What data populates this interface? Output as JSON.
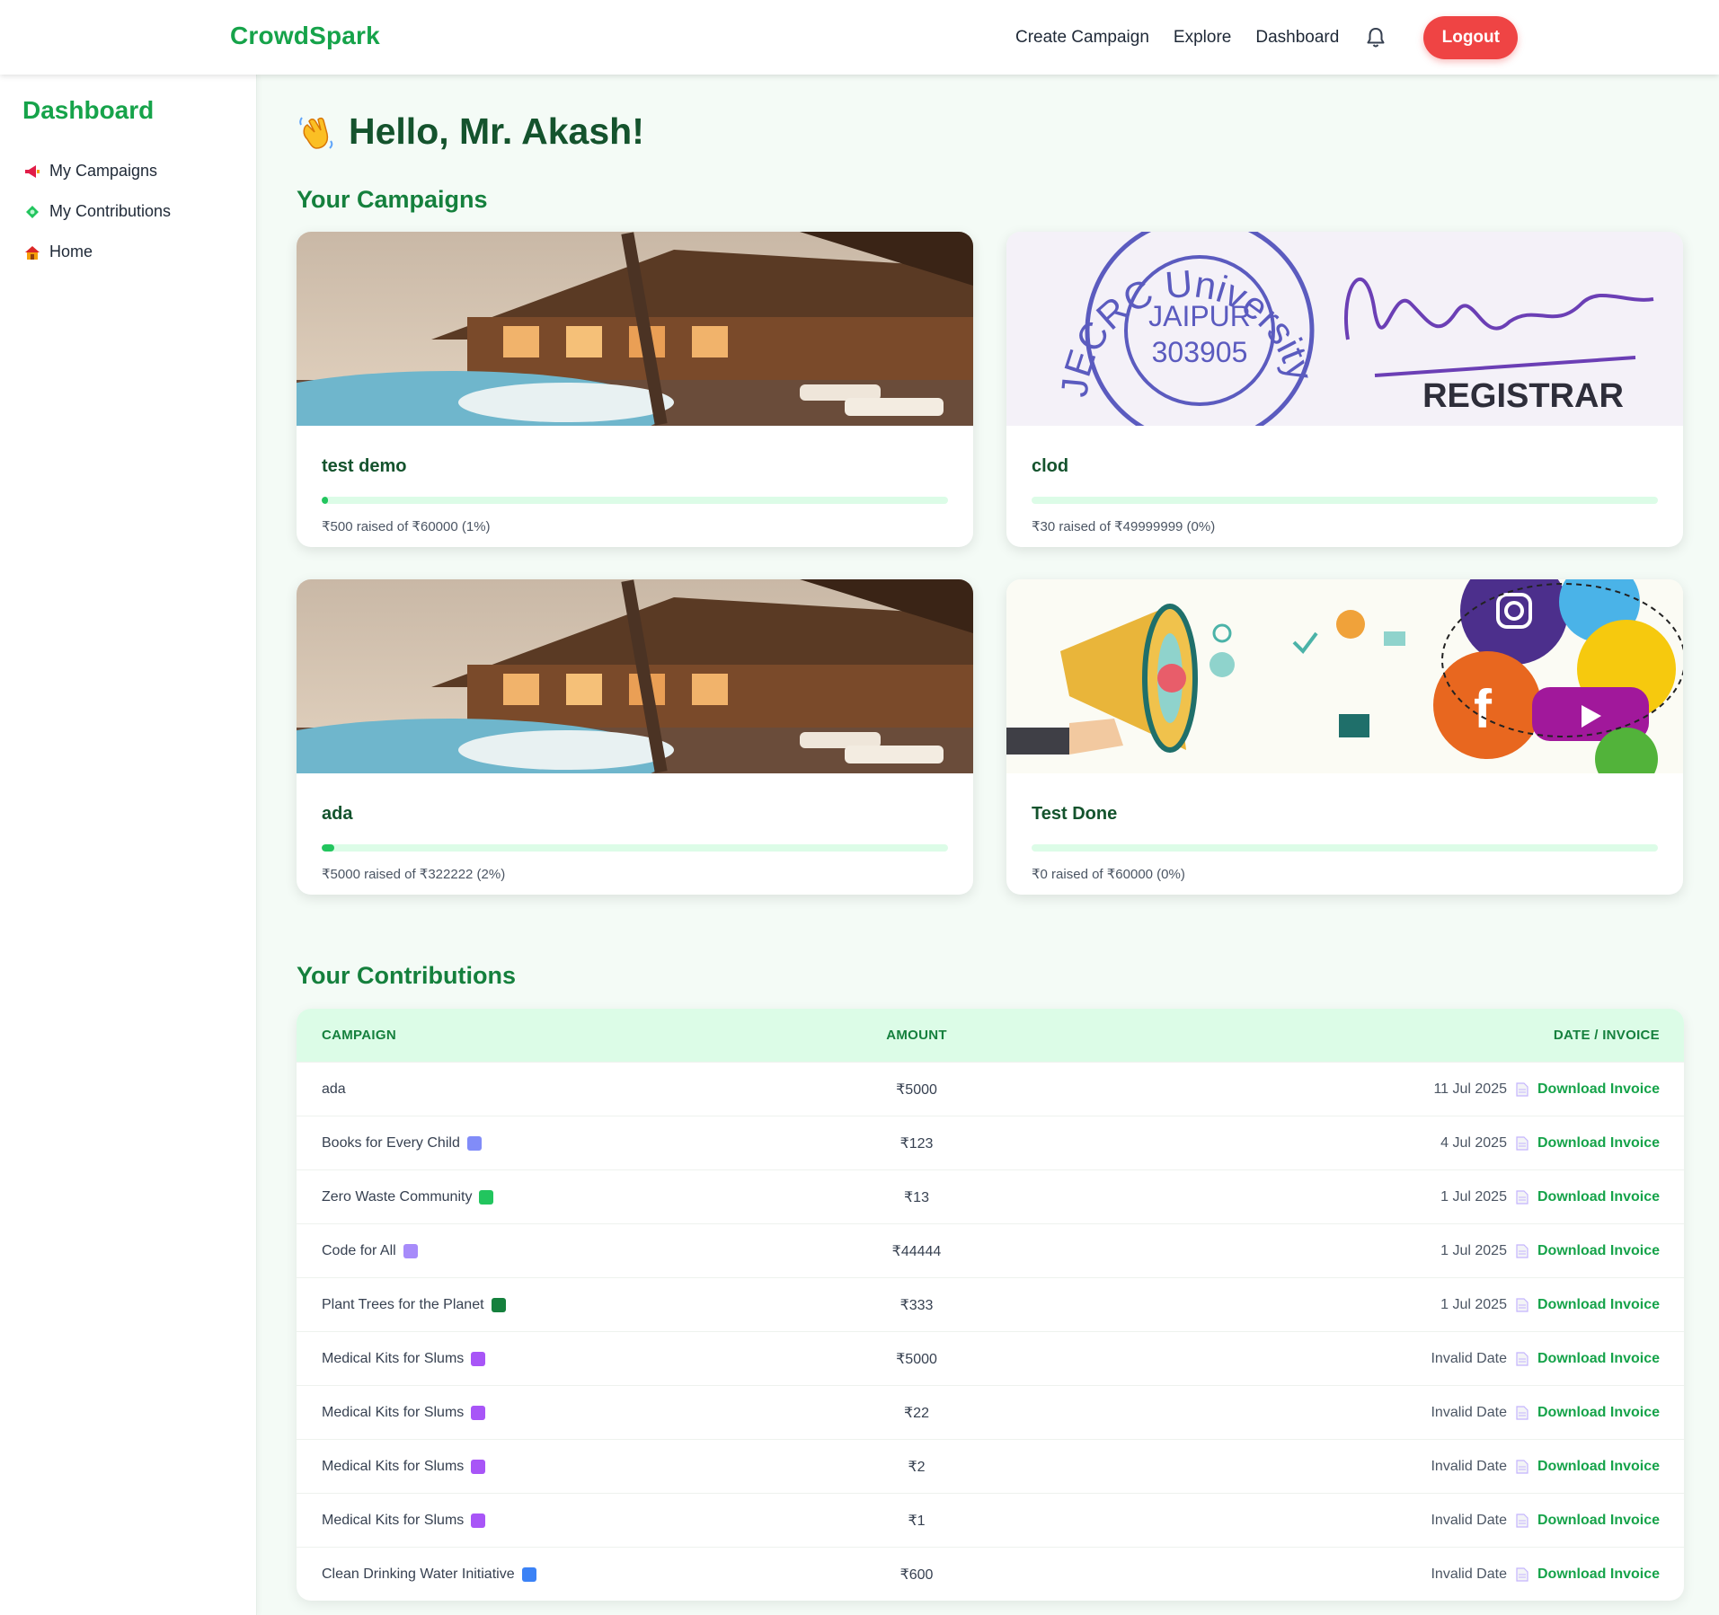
{
  "header": {
    "brand": "CrowdSpark",
    "nav": [
      "Create Campaign",
      "Explore",
      "Dashboard"
    ],
    "logout_label": "Logout"
  },
  "sidebar": {
    "title": "Dashboard",
    "items": [
      {
        "label": "My Campaigns",
        "icon": "megaphone-icon"
      },
      {
        "label": "My Contributions",
        "icon": "money-icon"
      },
      {
        "label": "Home",
        "icon": "home-icon"
      }
    ]
  },
  "greeting": "Hello, Mr. Akash!",
  "campaigns_title": "Your Campaigns",
  "campaigns": [
    {
      "title": "test demo",
      "raised_text": "₹500 raised of ₹60000 (1%)",
      "progress": 0.01,
      "image": "resort-pool-photo"
    },
    {
      "title": "clod",
      "raised_text": "₹30 raised of ₹49999999 (0%)",
      "progress": 0.0,
      "image": "university-stamp-signature",
      "image_text": {
        "seal_ring": "JECRC University",
        "seal_center_1": "JAIPUR",
        "seal_center_2": "303905",
        "caption": "REGISTRAR"
      }
    },
    {
      "title": "ada",
      "raised_text": "₹5000 raised of ₹322222 (2%)",
      "progress": 0.02,
      "image": "resort-pool-photo"
    },
    {
      "title": "Test Done",
      "raised_text": "₹0 raised of ₹60000 (0%)",
      "progress": 0.0,
      "image": "megaphone-social-media-illustration"
    }
  ],
  "contributions_title": "Your Contributions",
  "table": {
    "headers": [
      "CAMPAIGN",
      "AMOUNT",
      "DATE / INVOICE"
    ],
    "invoice_label": "Download Invoice",
    "rows": [
      {
        "campaign": "ada",
        "amount": "₹5000",
        "date": "11 Jul 2025",
        "emoji": ""
      },
      {
        "campaign": "Books for Every Child",
        "amount": "₹123",
        "date": "4 Jul 2025",
        "emoji": "books-icon"
      },
      {
        "campaign": "Zero Waste Community",
        "amount": "₹13",
        "date": "1 Jul 2025",
        "emoji": "recycle-icon"
      },
      {
        "campaign": "Code for All",
        "amount": "₹44444",
        "date": "1 Jul 2025",
        "emoji": "coder-icon"
      },
      {
        "campaign": "Plant Trees for the Planet",
        "amount": "₹333",
        "date": "1 Jul 2025",
        "emoji": "tree-icon"
      },
      {
        "campaign": "Medical Kits for Slums",
        "amount": "₹5000",
        "date": "Invalid Date",
        "emoji": "medkit-icon"
      },
      {
        "campaign": "Medical Kits for Slums",
        "amount": "₹22",
        "date": "Invalid Date",
        "emoji": "medkit-icon"
      },
      {
        "campaign": "Medical Kits for Slums",
        "amount": "₹2",
        "date": "Invalid Date",
        "emoji": "medkit-icon"
      },
      {
        "campaign": "Medical Kits for Slums",
        "amount": "₹1",
        "date": "Invalid Date",
        "emoji": "medkit-icon"
      },
      {
        "campaign": "Clean Drinking Water Initiative",
        "amount": "₹600",
        "date": "Invalid Date",
        "emoji": "water-icon"
      }
    ]
  },
  "colors": {
    "brand": "#16a34a",
    "logout": "#ef4444",
    "progress": "#22c55e",
    "table_header_bg": "#dcfce7"
  }
}
